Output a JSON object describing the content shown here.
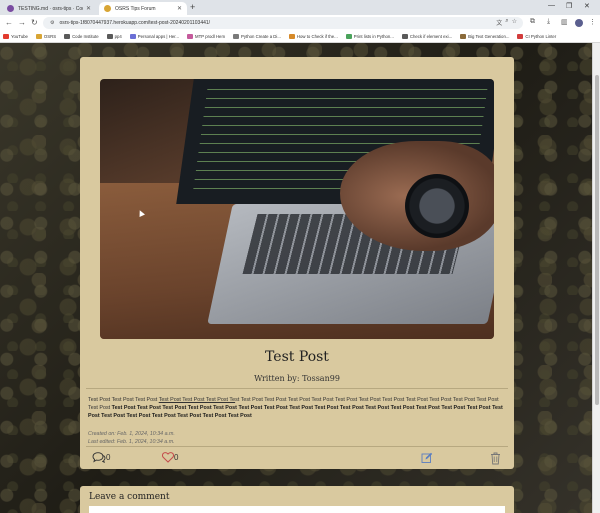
{
  "browser": {
    "tabs": [
      {
        "title": "TESTING.md · osrs-tips · Codes",
        "favicon_color": "#7a4ca1"
      },
      {
        "title": "OSRS Tips Forum",
        "favicon_color": "#d8a534",
        "active": true
      }
    ],
    "url": "osrs-tips-1f8070447937.herokuapp.com/test-post-20240201103441/",
    "bookmarks": [
      {
        "label": "YouTube",
        "color": "#e23b2e"
      },
      {
        "label": "OSRS",
        "color": "#d8a534"
      },
      {
        "label": "Code Institute",
        "color": "#5a5a5a"
      },
      {
        "label": "pp4",
        "color": "#5a5a5a"
      },
      {
        "label": "Personal apps | Her...",
        "color": "#6b6fd6"
      },
      {
        "label": "MTP prodl Hem",
        "color": "#c55a9c"
      },
      {
        "label": "Python Create a Di...",
        "color": "#7a7a7a"
      },
      {
        "label": "How to Check if the...",
        "color": "#d68a2a"
      },
      {
        "label": "Print lists in Python...",
        "color": "#4aa35b"
      },
      {
        "label": "Check if element exi...",
        "color": "#5a5a5a"
      },
      {
        "label": "Big Text Generation...",
        "color": "#8a6a3a"
      },
      {
        "label": "CI Python Linter",
        "color": "#d23c3c"
      }
    ]
  },
  "post": {
    "title": "Test Post",
    "author": "Written by: Tossan99",
    "content_plain": "Test Post Test Post Test Post ",
    "content_link": "Test Post Test Post Test Post Te",
    "content_plain2": "st Test Post Test Post Test Post Test Post Test Post Test Post Test Post Test Post Test Post Test Post Test Post Test Post ",
    "content_bold": "Test Post Test Post Test Post Test Post Test Post Test Post Test Post Test Post Test Post Test Post Test Post Test Post Test Post Test Post Test Post Test Post Test Post Test Post Test Post Test Post Test Post Test Post",
    "created": "Created on: Feb. 1, 2024, 10:34 a.m.",
    "edited": "Last edited: Feb. 1, 2024, 10:34 a.m.",
    "comment_count": "0",
    "like_count": "0"
  },
  "comments": {
    "heading": "Leave a comment"
  },
  "colors": {
    "card": "#d9c99f",
    "like_icon": "#c44b4b",
    "edit_icon": "#5a7ec0",
    "delete_icon": "#777777"
  }
}
